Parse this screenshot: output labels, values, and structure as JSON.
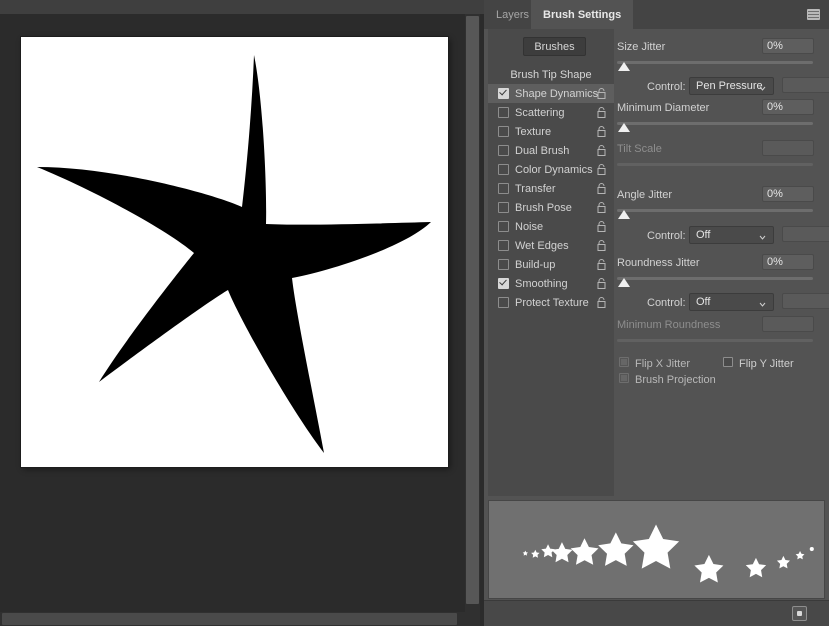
{
  "document": {
    "canvas_background": "#ffffff",
    "artwork": "black-five-point-star",
    "artwork_color": "#000000"
  },
  "panel": {
    "tabs": [
      {
        "label": "Layers",
        "active": false
      },
      {
        "label": "Brush Settings",
        "active": true
      }
    ],
    "menu_icon": "panel-menu-icon",
    "resize_cursor": "↔",
    "brushes_button": "Brushes",
    "options": {
      "header": "Brush Tip Shape",
      "items": [
        {
          "label": "Shape Dynamics",
          "checked": true,
          "selected": true,
          "lock": "unlocked-icon"
        },
        {
          "label": "Scattering",
          "checked": false,
          "selected": false,
          "lock": "unlocked-icon"
        },
        {
          "label": "Texture",
          "checked": false,
          "selected": false,
          "lock": "unlocked-icon"
        },
        {
          "label": "Dual Brush",
          "checked": false,
          "selected": false,
          "lock": "unlocked-icon"
        },
        {
          "label": "Color Dynamics",
          "checked": false,
          "selected": false,
          "lock": "unlocked-icon"
        },
        {
          "label": "Transfer",
          "checked": false,
          "selected": false,
          "lock": "unlocked-icon"
        },
        {
          "label": "Brush Pose",
          "checked": false,
          "selected": false,
          "lock": "unlocked-icon"
        },
        {
          "label": "Noise",
          "checked": false,
          "selected": false,
          "lock": "unlocked-icon"
        },
        {
          "label": "Wet Edges",
          "checked": false,
          "selected": false,
          "lock": "unlocked-icon"
        },
        {
          "label": "Build-up",
          "checked": false,
          "selected": false,
          "lock": "unlocked-icon"
        },
        {
          "label": "Smoothing",
          "checked": true,
          "selected": false,
          "lock": "unlocked-icon"
        },
        {
          "label": "Protect Texture",
          "checked": false,
          "selected": false,
          "lock": "unlocked-icon"
        }
      ]
    },
    "settings": {
      "size_jitter": {
        "label": "Size Jitter",
        "value": "0%",
        "slider_percent": 0
      },
      "size_jitter_control": {
        "label": "Control:",
        "value": "Pen Pressure",
        "extra_value": ""
      },
      "minimum_diameter": {
        "label": "Minimum Diameter",
        "value": "0%",
        "slider_percent": 0
      },
      "tilt_scale": {
        "label": "Tilt Scale",
        "value": "",
        "slider_percent": 0,
        "disabled": true
      },
      "angle_jitter": {
        "label": "Angle Jitter",
        "value": "0%",
        "slider_percent": 0
      },
      "angle_jitter_control": {
        "label": "Control:",
        "value": "Off",
        "extra_value": ""
      },
      "roundness_jitter": {
        "label": "Roundness Jitter",
        "value": "0%",
        "slider_percent": 0
      },
      "roundness_jitter_control": {
        "label": "Control:",
        "value": "Off",
        "extra_value": ""
      },
      "minimum_roundness": {
        "label": "Minimum Roundness",
        "value": "",
        "slider_percent": 0,
        "disabled": true
      },
      "flip_x_jitter": {
        "label": "Flip X Jitter",
        "checked": false,
        "disabled": true
      },
      "flip_y_jitter": {
        "label": "Flip Y Jitter",
        "checked": false,
        "disabled": false
      },
      "brush_projection": {
        "label": "Brush Projection",
        "checked": false,
        "disabled": true
      }
    },
    "preview": {
      "name": "brush-stroke-preview",
      "description": "star-brush-stroke"
    },
    "footer": {
      "new_brush_icon": "new-brush-preset-icon"
    }
  },
  "colors": {
    "panel_bg": "#535353",
    "tabbar_bg": "#444444",
    "option_col_bg": "#4a4a4a",
    "selected_row": "#5e5e5e",
    "doc_bg": "#2b2b2b",
    "preview_bg": "#707070",
    "text": "#d2d2d2",
    "text_dim": "#8e8e8e"
  }
}
